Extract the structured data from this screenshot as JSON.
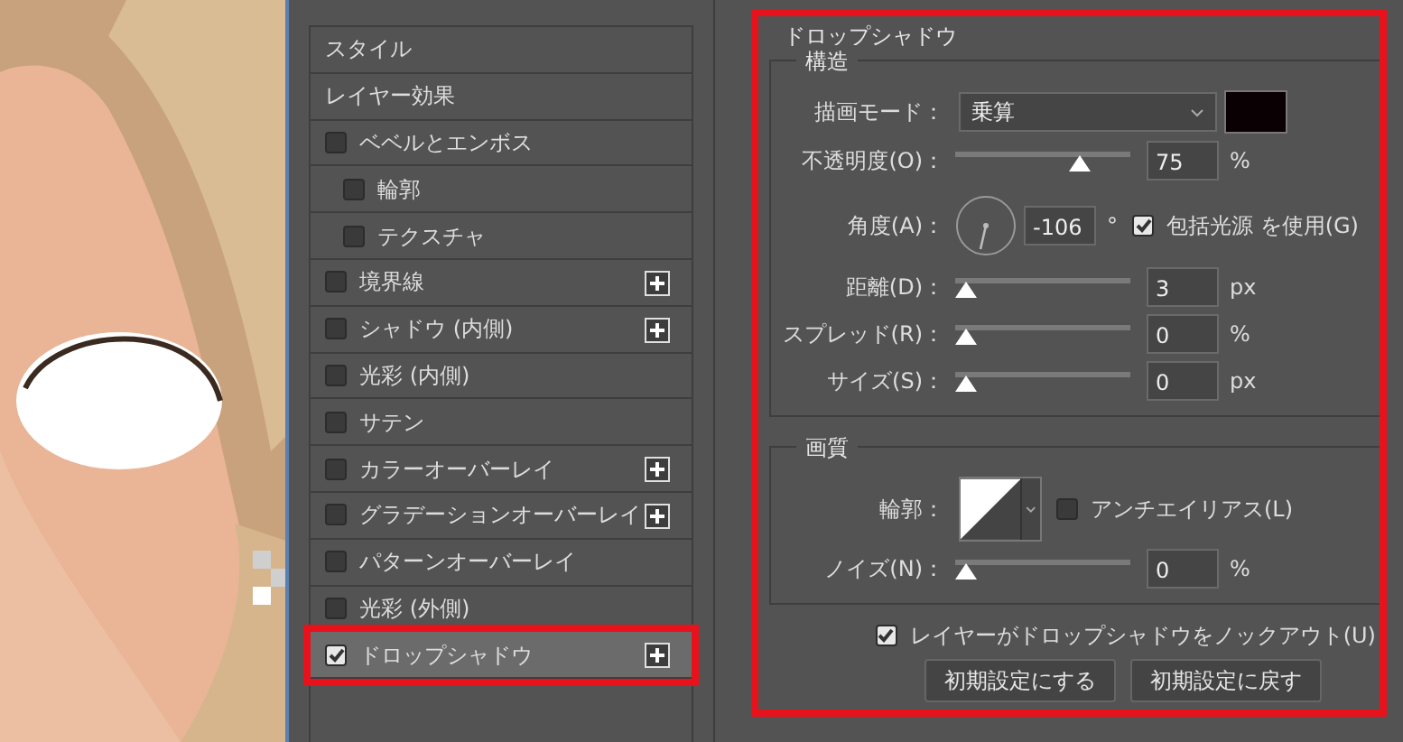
{
  "effects_list": {
    "items": [
      {
        "label": "スタイル",
        "kind": "header"
      },
      {
        "label": "レイヤー効果",
        "kind": "header"
      },
      {
        "label": "ベベルとエンボス",
        "kind": "check",
        "checked": false,
        "selected": false,
        "addable": false
      },
      {
        "label": "輪郭",
        "kind": "subcheck",
        "checked": false,
        "selected": false,
        "addable": false
      },
      {
        "label": "テクスチャ",
        "kind": "subcheck",
        "checked": false,
        "selected": false,
        "addable": false
      },
      {
        "label": "境界線",
        "kind": "check",
        "checked": false,
        "selected": false,
        "addable": true
      },
      {
        "label": "シャドウ (内側)",
        "kind": "check",
        "checked": false,
        "selected": false,
        "addable": true
      },
      {
        "label": "光彩 (内側)",
        "kind": "check",
        "checked": false,
        "selected": false,
        "addable": false
      },
      {
        "label": "サテン",
        "kind": "check",
        "checked": false,
        "selected": false,
        "addable": false
      },
      {
        "label": "カラーオーバーレイ",
        "kind": "check",
        "checked": false,
        "selected": false,
        "addable": true
      },
      {
        "label": "グラデーションオーバーレイ",
        "kind": "check",
        "checked": false,
        "selected": false,
        "addable": true
      },
      {
        "label": "パターンオーバーレイ",
        "kind": "check",
        "checked": false,
        "selected": false,
        "addable": false
      },
      {
        "label": "光彩 (外側)",
        "kind": "check",
        "checked": false,
        "selected": false,
        "addable": false
      },
      {
        "label": "ドロップシャドウ",
        "kind": "check",
        "checked": true,
        "selected": true,
        "addable": true,
        "highlighted": true
      }
    ]
  },
  "panel": {
    "title": "ドロップシャドウ",
    "highlighted": true,
    "structure": {
      "title": "構造",
      "rows": [
        {
          "kind": "select",
          "label": "描画モード：",
          "value": "乗算",
          "color": "#0a0003"
        },
        {
          "kind": "slider",
          "label": "不透明度(O)：",
          "level": 0.74,
          "value": "75",
          "unit": "%"
        },
        {
          "kind": "angle",
          "label": "角度(A)：",
          "value": "-106",
          "unit": "°",
          "option": {
            "label": "包括光源 を使用(G)",
            "checked": true
          }
        },
        {
          "kind": "slider",
          "label": "距離(D)：",
          "level": 0,
          "value": "3",
          "unit": "px"
        },
        {
          "kind": "slider",
          "label": "スプレッド(R)：",
          "level": 0,
          "value": "0",
          "unit": "%"
        },
        {
          "kind": "slider",
          "label": "サイズ(S)：",
          "level": 0,
          "value": "0",
          "unit": "px"
        }
      ]
    },
    "quality": {
      "title": "画質",
      "rows": [
        {
          "kind": "contour",
          "label": "輪郭：",
          "option": {
            "label": "アンチエイリアス(L)",
            "checked": false
          }
        },
        {
          "kind": "slider",
          "label": "ノイズ(N)：",
          "level": 0,
          "value": "0",
          "unit": "%"
        }
      ]
    },
    "knockout": {
      "label": "レイヤーがドロップシャドウをノックアウト(U)",
      "checked": true
    },
    "buttons": [
      "初期設定にする",
      "初期設定に戻す"
    ]
  }
}
